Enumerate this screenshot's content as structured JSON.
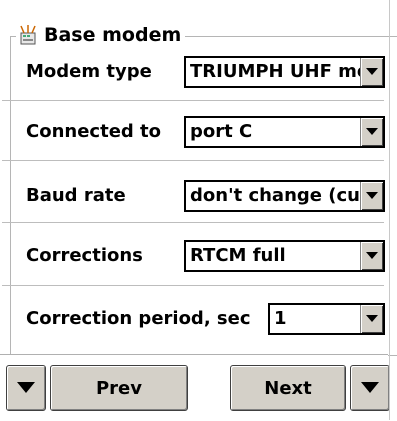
{
  "group": {
    "title": "Base modem",
    "icon": "modem-icon"
  },
  "fields": [
    {
      "label": "Modem type",
      "value": "TRIUMPH UHF modem"
    },
    {
      "label": "Connected to",
      "value": "port C"
    },
    {
      "label": "Baud rate",
      "value": "don't change (current)"
    },
    {
      "label": "Corrections",
      "value": "RTCM full"
    },
    {
      "label": "Correction period, sec",
      "value": "1"
    }
  ],
  "nav": {
    "prev_label": "Prev",
    "next_label": "Next",
    "left_menu_icon": "triangle-down-icon",
    "right_menu_icon": "triangle-down-icon"
  }
}
